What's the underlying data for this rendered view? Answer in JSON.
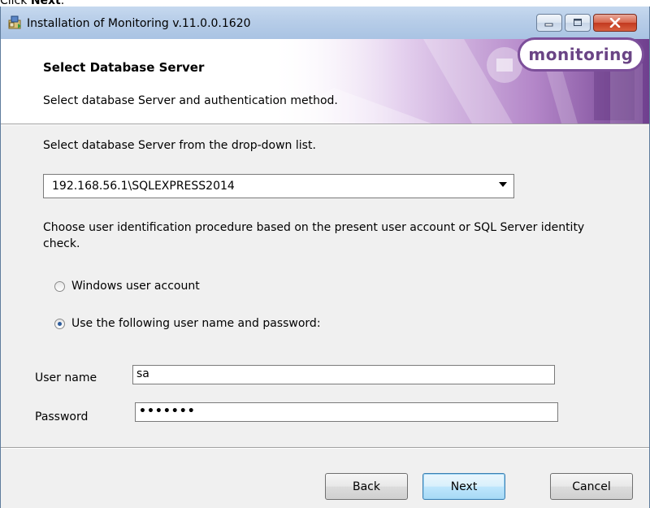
{
  "caption": {
    "prefix": "Click ",
    "bold": "Next"
  },
  "window": {
    "title": "Installation of Monitoring v.11.0.0.1620"
  },
  "header": {
    "title": "Select Database Server",
    "subtitle": "Select database Server and authentication method.",
    "logo_text": "monitoring"
  },
  "server": {
    "prompt": "Select database Server from the drop-down list.",
    "selected": "192.168.56.1\\SQLEXPRESS2014"
  },
  "auth": {
    "description": "Choose user identification procedure based on the present user account or SQL Server identity check.",
    "options": [
      {
        "label": "Windows user account",
        "checked": false
      },
      {
        "label": "Use the following user name and password:",
        "checked": true
      }
    ]
  },
  "credentials": {
    "username_label": "User name",
    "username_value": "sa",
    "password_label": "Password",
    "password_value": "•••••••"
  },
  "buttons": {
    "back": "Back",
    "next": "Next",
    "cancel": "Cancel"
  }
}
